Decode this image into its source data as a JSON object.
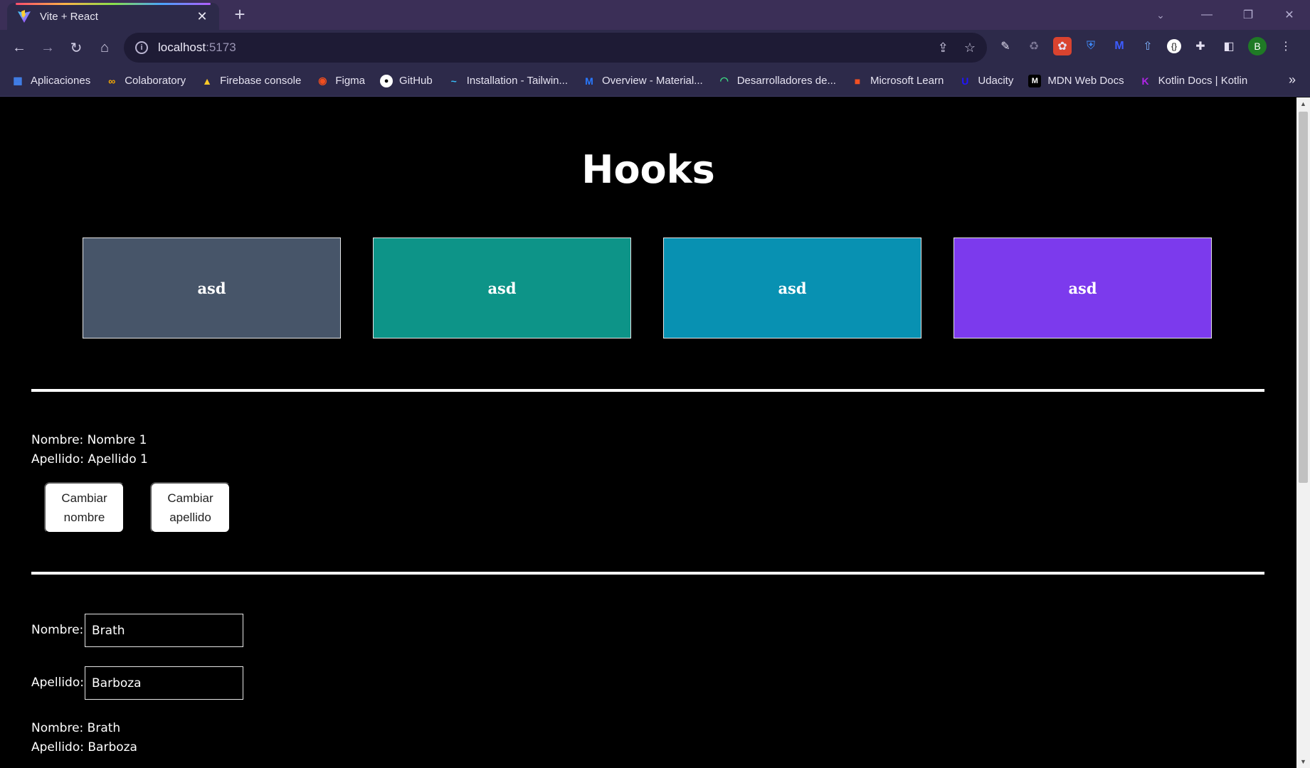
{
  "browser": {
    "tab_title": "Vite + React",
    "tab_close": "✕",
    "new_tab": "+",
    "url_host": "localhost",
    "url_port": ":5173",
    "bookmarks": [
      {
        "label": "Aplicaciones",
        "icon": "apps-grid-icon",
        "color": "#4285f4"
      },
      {
        "label": "Colaboratory",
        "icon": "colab-icon",
        "color": "#f9ab00"
      },
      {
        "label": "Firebase console",
        "icon": "firebase-icon",
        "color": "#ffca28"
      },
      {
        "label": "Figma",
        "icon": "figma-icon",
        "color": "#f24e1e"
      },
      {
        "label": "GitHub",
        "icon": "github-icon",
        "color": "#ffffff"
      },
      {
        "label": "Installation - Tailwin...",
        "icon": "tailwind-icon",
        "color": "#38bdf8"
      },
      {
        "label": "Overview - Material...",
        "icon": "material-icon",
        "color": "#2979ff"
      },
      {
        "label": "Desarrolladores de...",
        "icon": "android-icon",
        "color": "#3ddc84"
      },
      {
        "label": "Microsoft Learn",
        "icon": "microsoft-icon",
        "color": "#f25022"
      },
      {
        "label": "Udacity",
        "icon": "udacity-icon",
        "color": "#2015ff"
      },
      {
        "label": "MDN Web Docs",
        "icon": "mdn-icon",
        "color": "#000000"
      },
      {
        "label": "Kotlin Docs | Kotlin",
        "icon": "kotlin-icon",
        "color": "#b125ea"
      }
    ],
    "bookmarks_more": "»",
    "profile_initial": "B"
  },
  "page": {
    "title": "Hooks",
    "cards": [
      {
        "label": "asd",
        "color": "#475569"
      },
      {
        "label": "asd",
        "color": "#0d9488"
      },
      {
        "label": "asd",
        "color": "#0891b2"
      },
      {
        "label": "asd",
        "color": "#7c3aed"
      }
    ],
    "section1": {
      "nombre_line": "Nombre: Nombre 1",
      "apellido_line": "Apellido: Apellido 1",
      "btn_nombre_l1": "Cambiar",
      "btn_nombre_l2": "nombre",
      "btn_apellido_l1": "Cambiar",
      "btn_apellido_l2": "apellido"
    },
    "section2": {
      "nombre_label": "Nombre:",
      "nombre_value": "Brath",
      "apellido_label": "Apellido:",
      "apellido_value": "Barboza",
      "nombre_line": "Nombre: Brath",
      "apellido_line": "Apellido: Barboza"
    }
  }
}
